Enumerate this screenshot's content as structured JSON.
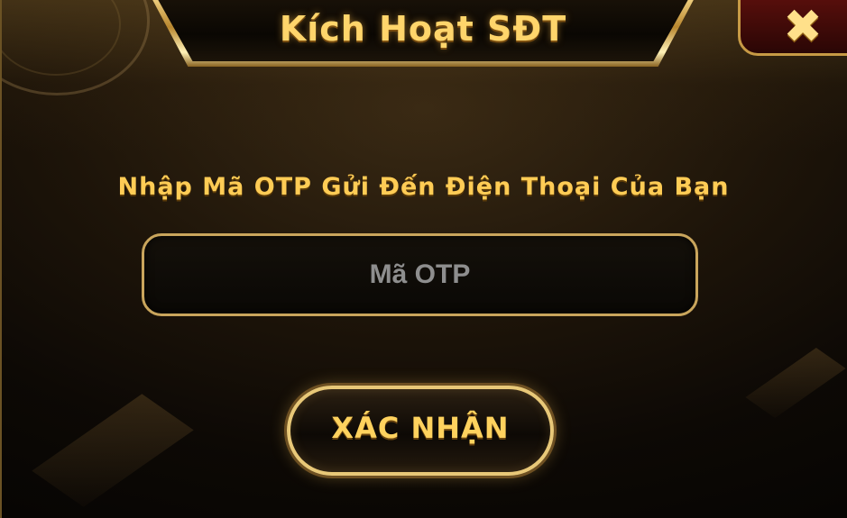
{
  "dialog": {
    "title": "Kích Hoạt SĐT",
    "close_glyph": "✖",
    "close_icon": "close-icon",
    "instruction": "Nhập Mã OTP Gửi Đến Điện Thoại Của Bạn",
    "otp": {
      "value": "",
      "placeholder": "Mã OTP"
    },
    "confirm_label": "XÁC NHẬN"
  },
  "colors": {
    "gold_text": "#ffd25e",
    "title_gold": "#ffd56b",
    "border_gold": "#c9a55c",
    "close_bg": "#5a0f0c",
    "placeholder_gray": "#8e8e8e"
  }
}
